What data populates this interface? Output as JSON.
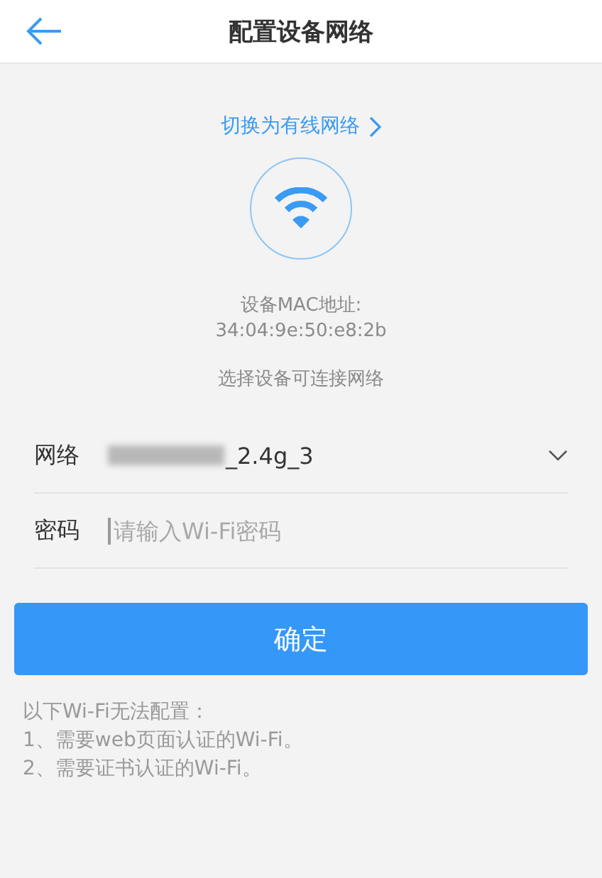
{
  "header": {
    "title": "配置设备网络"
  },
  "switch_link": "切换为有线网络",
  "mac": {
    "label": "设备MAC地址:",
    "value": "34:04:9e:50:e8:2b"
  },
  "hint": "选择设备可连接网络",
  "network": {
    "label": "网络",
    "value": "_2.4g_3"
  },
  "password": {
    "label": "密码",
    "placeholder": "请输入Wi-Fi密码"
  },
  "confirm_button": "确定",
  "notes": [
    "以下Wi-Fi无法配置：",
    "1、需要web页面认证的Wi-Fi。",
    "2、需要证书认证的Wi-Fi。"
  ]
}
